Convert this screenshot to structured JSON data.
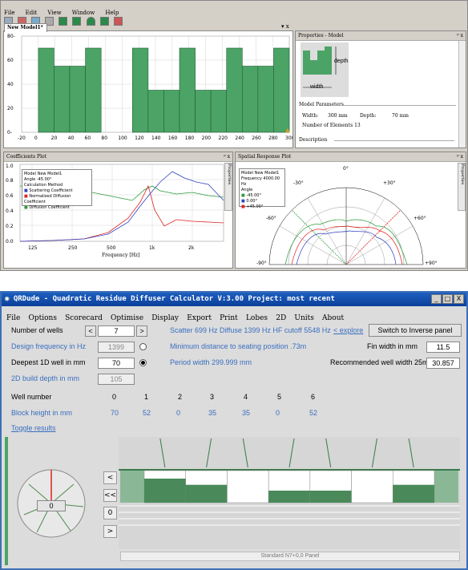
{
  "top": {
    "menu": [
      "File",
      "Edit",
      "View",
      "Window",
      "Help"
    ],
    "model_tab": "New Model1*",
    "close_x": "▾ x",
    "model_plot": {
      "x_ticks": [
        "-20",
        "0",
        "20",
        "40",
        "60",
        "80",
        "100",
        "120",
        "140",
        "160",
        "180",
        "200",
        "220",
        "240",
        "260",
        "280",
        "300"
      ],
      "y_ticks": [
        "0-",
        "20",
        "40",
        "60",
        "80-"
      ],
      "depths": [
        70,
        55,
        55,
        70,
        0,
        0,
        70,
        35,
        35,
        70,
        35,
        35,
        70,
        55,
        55,
        70
      ]
    },
    "properties": {
      "title": "Properties - Model",
      "pin": "ᵖ x",
      "depth_label": "depth",
      "width_label": "width",
      "params_title": "Model Parameters",
      "width_text": "Width:",
      "width_val": "300 mm",
      "depth_text": "Depth:",
      "depth_val": "70 mm",
      "elements_text": "Number of Elements 13",
      "desc_text": "Description"
    },
    "coef": {
      "title": "Coefficients Plot",
      "pin": "ᵖ x",
      "y_ticks": [
        "1.0",
        "0.8",
        "0.6",
        "0.4",
        "0.2",
        "0.0"
      ],
      "x_ticks": [
        "125",
        "250",
        "500",
        "1k",
        "2k"
      ],
      "xlabel": "Frequency [Hz]",
      "legend": [
        "Model    New Model1",
        "Angle    -45.00°",
        "Calculation Method",
        "Scattering Coefficient",
        "Normalized Diffusion Coefficient",
        "Diffusion Coefficient"
      ],
      "side": "Properties"
    },
    "spatial": {
      "title": "Spatial Response Plot",
      "pin": "ᵖ x",
      "legend": [
        "Model     New Model1",
        "Frequency  4000.00 Hz",
        "Angle",
        "-45.00°",
        "0.00°",
        "+45.00°"
      ],
      "angles": [
        "-30°",
        "+30°",
        "-60°",
        "+60°",
        "-90°",
        "+90°",
        "0°"
      ],
      "side": "Properties"
    }
  },
  "bottom": {
    "title": "QRDude - Quadratic Residue Diffuser Calculator    V:3.00    Project: most recent",
    "win_buttons": [
      "_",
      "□",
      "X"
    ],
    "menu": [
      "File",
      "Options",
      "Scorecard",
      "Optimise",
      "Display",
      "Export",
      "Print",
      "Lobes",
      "2D",
      "Units",
      "About"
    ],
    "labels": {
      "num_wells": "Number of wells",
      "design_freq": "Design frequency in Hz",
      "deepest": "Deepest 1D well in mm",
      "build_depth": "2D build depth in mm",
      "well_number": "Well number",
      "block_height": "Block height in mm",
      "toggle": "Toggle results"
    },
    "values": {
      "num_wells": "7",
      "design_freq": "1399",
      "deepest": "70",
      "build_depth": "105",
      "fin_width": "11.5",
      "rec_width": "30.857"
    },
    "spin": {
      "down": "<",
      "up": ">"
    },
    "info": {
      "scatter": "Scatter 699 Hz  Diffuse 1399 Hz  HF cutoff 5548 Hz",
      "explore": "< explore",
      "min_dist": "Minimum distance to seating position .73m",
      "period": "Period width  299.999 mm",
      "fin_label": "Fin width in mm",
      "rec_label": "Recommended well width  25mm"
    },
    "switch_btn": "Switch to Inverse panel",
    "well_numbers": [
      "0",
      "1",
      "2",
      "3",
      "4",
      "5",
      "6"
    ],
    "block_heights": [
      "70",
      "52",
      "0",
      "35",
      "35",
      "0",
      "52"
    ],
    "side_buttons": [
      "<",
      "<<",
      "0",
      ">"
    ],
    "dial_value": "0",
    "panel_caption": "Standard N7+0,0 Panel"
  },
  "colors": {
    "bar": "#4ca366",
    "accent": "#3a6ebf",
    "title_blue": "#1c5fbf"
  }
}
